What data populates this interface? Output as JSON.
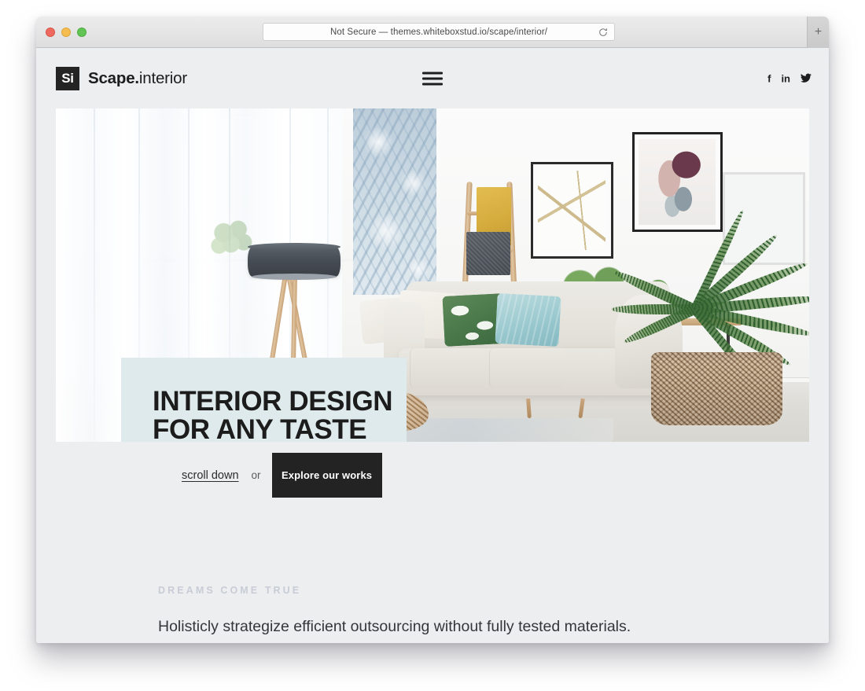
{
  "browser": {
    "url_text": "Not Secure — themes.whiteboxstud.io/scape/interior/",
    "reload_label": "Reload",
    "new_tab_label": "+",
    "traffic_lights": [
      "close",
      "minimize",
      "maximize"
    ]
  },
  "site": {
    "logo": {
      "mark": "Si",
      "name_bold": "Scape.",
      "name_light": "interior"
    },
    "menu_label": "Menu",
    "social": [
      {
        "name": "facebook",
        "label": "f"
      },
      {
        "name": "linkedin",
        "label": "in"
      },
      {
        "name": "twitter",
        "label": ""
      }
    ]
  },
  "hero": {
    "title": "INTERIOR DESIGN\nFOR ANY TASTE",
    "scroll_label": "scroll down",
    "or_label": "or",
    "cta_label": "Explore our works",
    "caption_bg": "#dfeaec",
    "image_alt": "Bright living room with tripod floor lamp, beige sofa with green and teal pillows, framed art and a palm in a woven basket"
  },
  "section": {
    "eyebrow": "DREAMS COME TRUE",
    "paragraph": "Holisticly strategize efficient outsourcing without fully tested materials.\nDynamically disseminate technically sound products."
  },
  "colors": {
    "page_bg": "#eceef0",
    "ink": "#1c1c1c",
    "accent_box": "#dfeaec",
    "button_bg": "#232323",
    "eyebrow": "#c8ccd6"
  }
}
